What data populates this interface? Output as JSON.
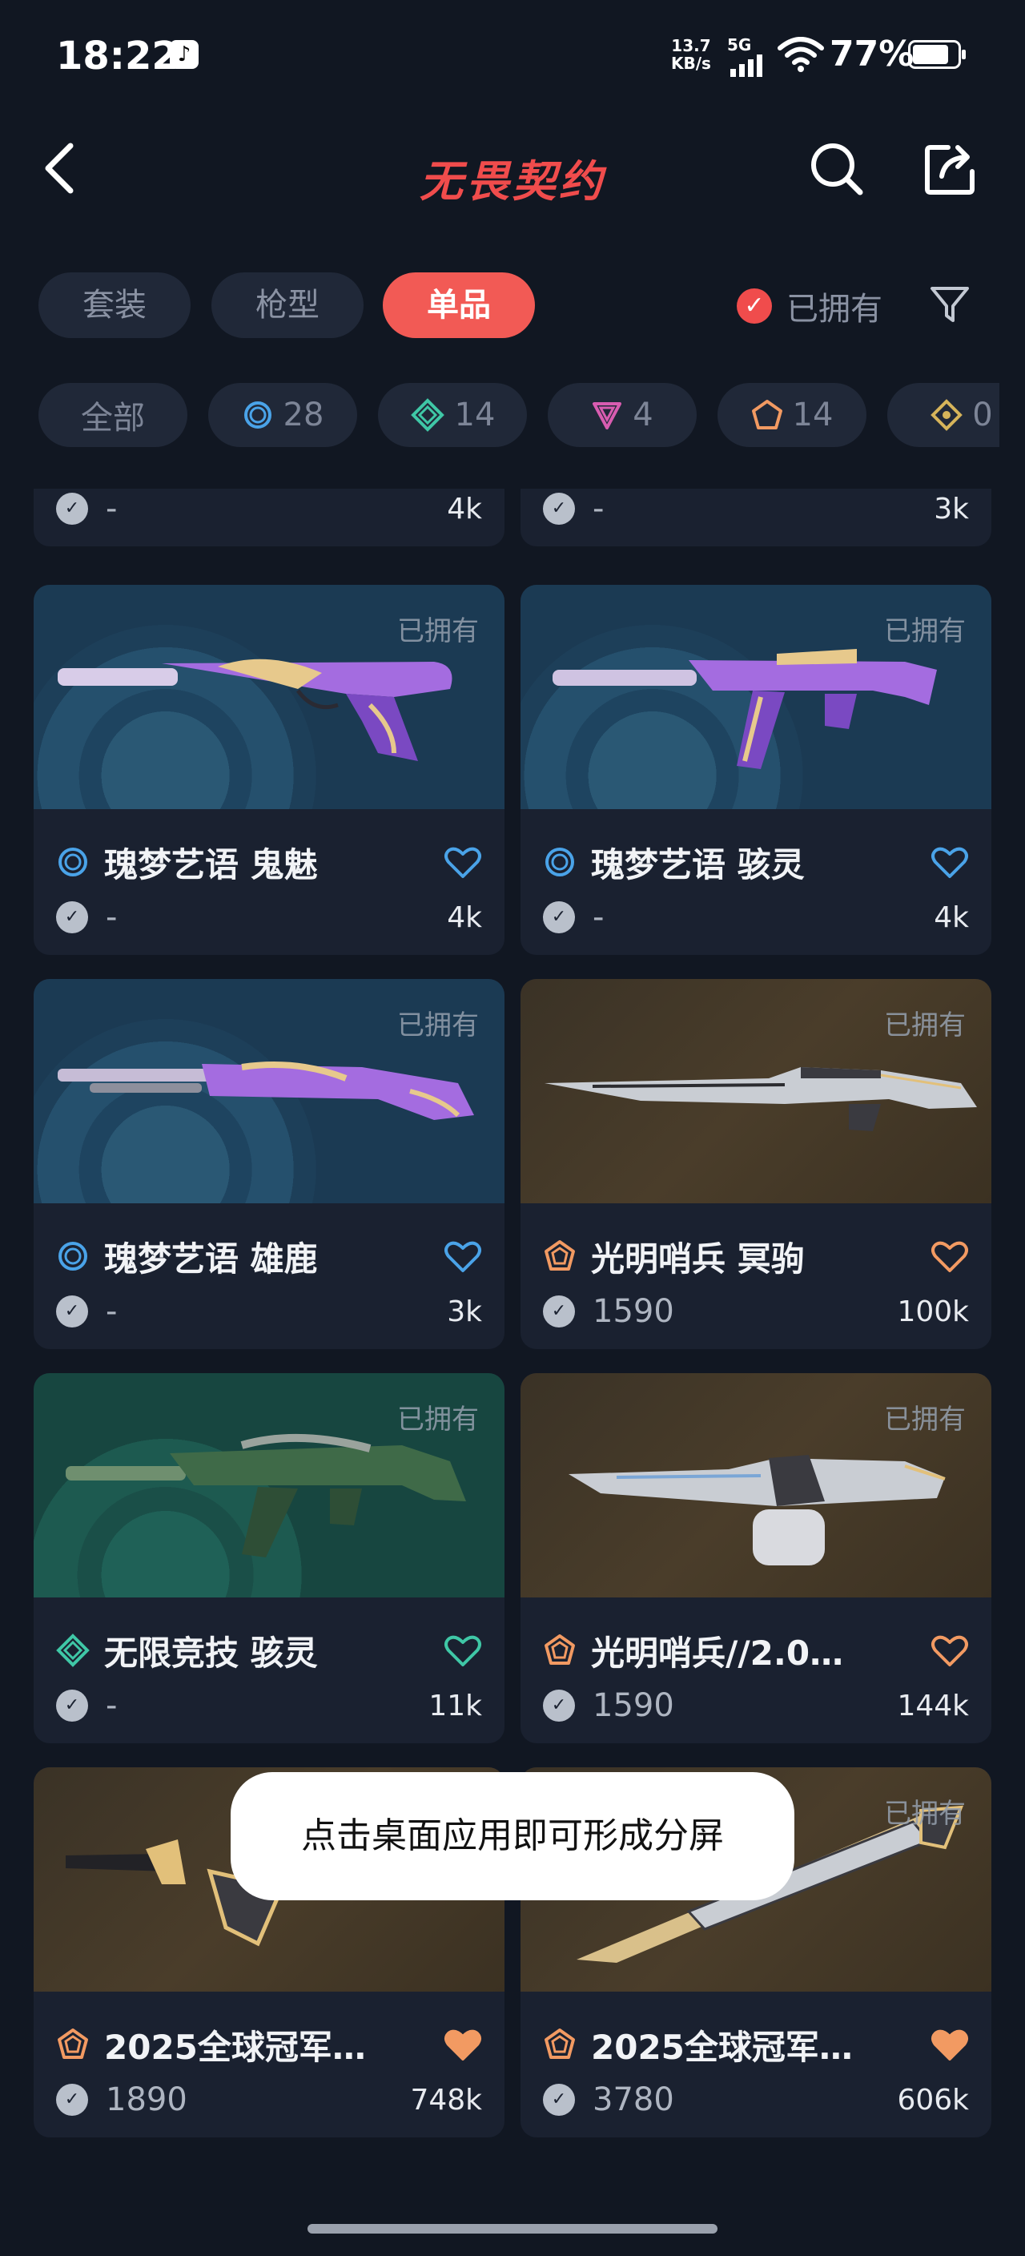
{
  "status_bar": {
    "time": "18:22",
    "net_speed_value": "13.7",
    "net_speed_unit": "KB/s",
    "network": "5G",
    "battery": "77%"
  },
  "nav": {
    "title": "无畏契约"
  },
  "segments": [
    {
      "label": "套装",
      "active": false
    },
    {
      "label": "枪型",
      "active": false
    },
    {
      "label": "单品",
      "active": true
    }
  ],
  "owned_filter": {
    "label": "已拥有"
  },
  "chips": [
    {
      "label": "全部",
      "count": ""
    },
    {
      "label": "",
      "count": "28"
    },
    {
      "label": "",
      "count": "14"
    },
    {
      "label": "",
      "count": "4"
    },
    {
      "label": "",
      "count": "14"
    },
    {
      "label": "",
      "count": "0"
    }
  ],
  "partial_cards": [
    {
      "price": "-",
      "likes": "4k"
    },
    {
      "price": "-",
      "likes": "3k"
    }
  ],
  "cards": [
    {
      "owned": "已拥有",
      "name": "瑰梦艺语 鬼魅",
      "price": "-",
      "likes": "4k",
      "rarity": "select-blue",
      "liked": false
    },
    {
      "owned": "已拥有",
      "name": "瑰梦艺语 骇灵",
      "price": "-",
      "likes": "4k",
      "rarity": "select-blue",
      "liked": false
    },
    {
      "owned": "已拥有",
      "name": "瑰梦艺语 雄鹿",
      "price": "-",
      "likes": "3k",
      "rarity": "select-blue",
      "liked": false
    },
    {
      "owned": "已拥有",
      "name": "光明哨兵 冥驹",
      "price": "1590",
      "likes": "100k",
      "rarity": "premium-orange",
      "liked": false
    },
    {
      "owned": "已拥有",
      "name": "无限竞技 骇灵",
      "price": "-",
      "likes": "11k",
      "rarity": "deluxe-teal",
      "liked": false
    },
    {
      "owned": "已拥有",
      "name": "光明哨兵//2.0…",
      "price": "1590",
      "likes": "144k",
      "rarity": "premium-orange",
      "liked": false
    },
    {
      "owned": "",
      "name": "2025全球冠军…",
      "price": "1890",
      "likes": "748k",
      "rarity": "premium-orange",
      "liked": true
    },
    {
      "owned": "已拥有",
      "name": "2025全球冠军…",
      "price": "3780",
      "likes": "606k",
      "rarity": "premium-orange",
      "liked": true
    }
  ],
  "toast": "点击桌面应用即可形成分屏",
  "colors": {
    "background": "#111722",
    "accent": "#f25a55",
    "select_blue": "#4aa3e8",
    "deluxe_teal": "#3fc7a6",
    "premium_orange": "#f29a62",
    "ultra_gold": "#d6b45a"
  }
}
